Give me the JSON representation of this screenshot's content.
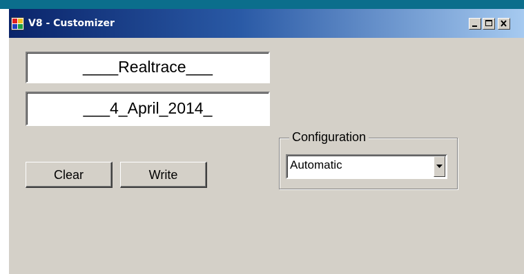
{
  "window": {
    "title": "V8 - Customizer",
    "icon": "app-window-icon",
    "controls": {
      "minimize_icon": "minimize-icon",
      "maximize_icon": "maximize-icon",
      "close_icon": "close-icon"
    }
  },
  "fields": {
    "name_value": "____Realtrace___",
    "date_value": "___4_April_2014_"
  },
  "buttons": {
    "clear_label": "Clear",
    "write_label": "Write"
  },
  "configuration": {
    "group_label": "Configuration",
    "selected_value": "Automatic",
    "dropdown_icon": "chevron-down-icon"
  },
  "colors": {
    "window_face": "#d4d0c8",
    "titlebar_start": "#0a246a",
    "titlebar_end": "#a6caf0",
    "desktop_strip": "#0b6e8c"
  }
}
